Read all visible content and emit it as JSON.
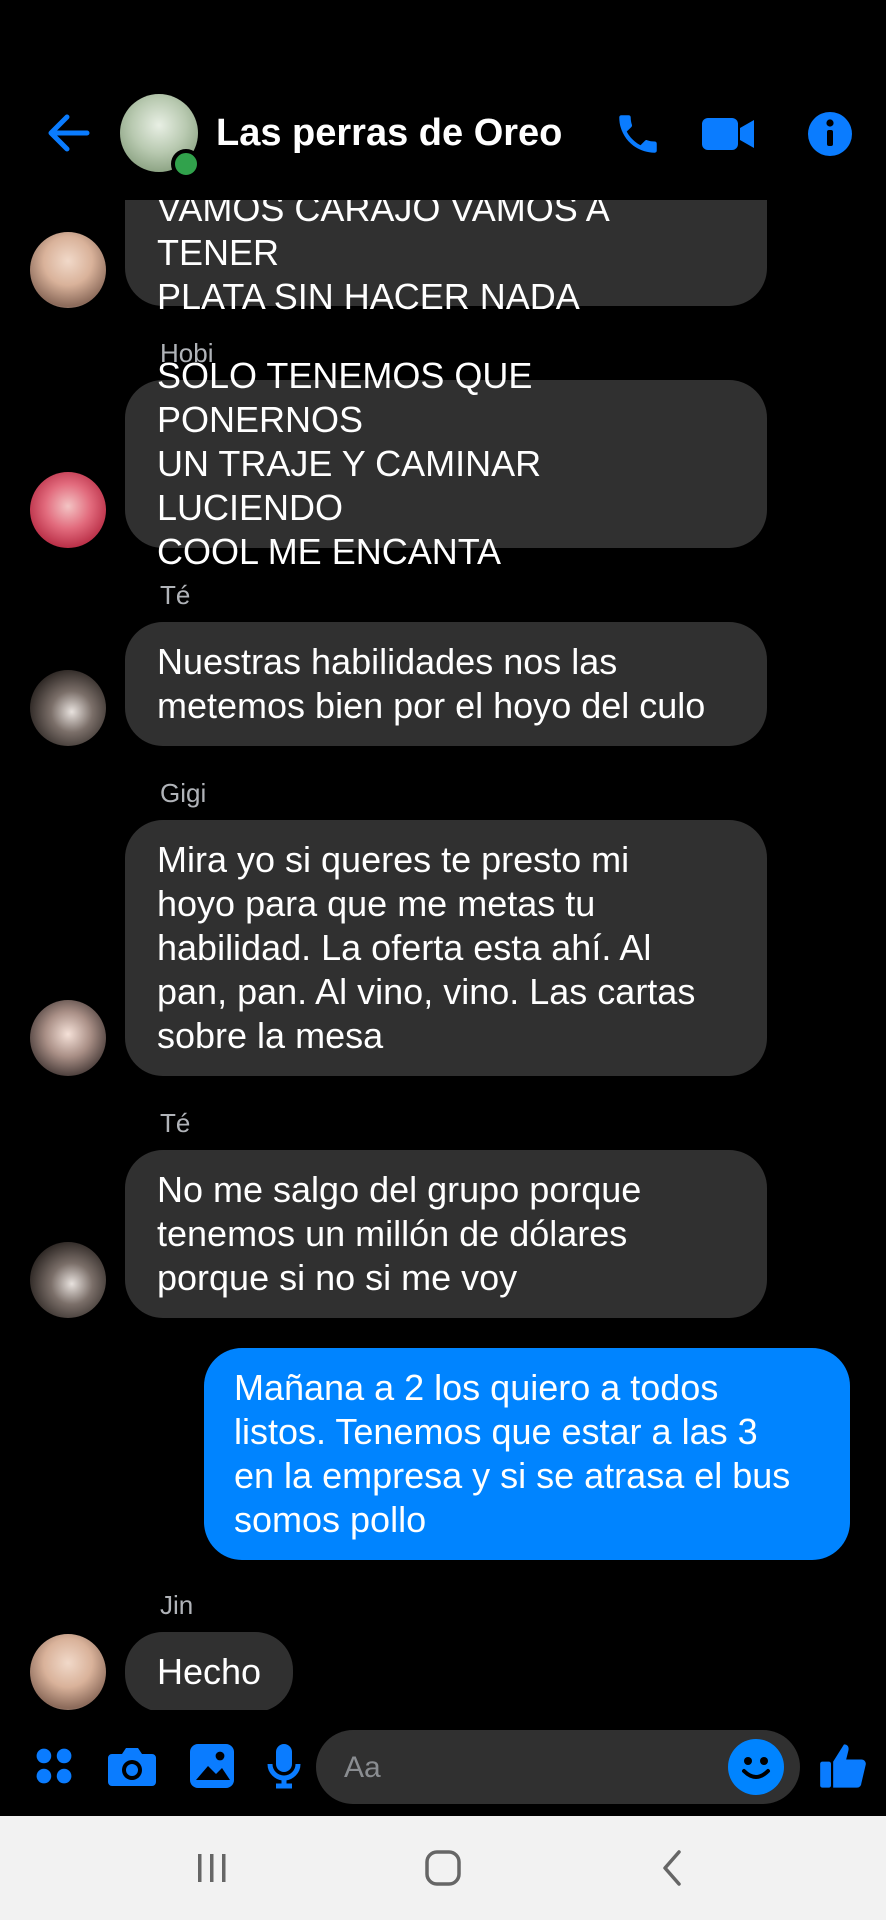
{
  "app": {
    "accent": "#0084ff",
    "incoming_bubble": "#303030",
    "background": "#000000"
  },
  "header": {
    "title": "Las perras de Oreo",
    "online": true,
    "icons": [
      "arrow-left-icon",
      "phone-icon",
      "video-camera-icon",
      "info-icon"
    ]
  },
  "messages": [
    {
      "direction": "in",
      "sender_label": "",
      "avatar": "jin",
      "lines": [
        "VAMOS CARAJO VAMOS A TENER",
        "PLATA SIN HACER NADA"
      ]
    },
    {
      "direction": "in",
      "sender_label": "Hobi",
      "avatar": "hobi",
      "lines": [
        "SOLO TENEMOS QUE PONERNOS",
        "UN TRAJE Y CAMINAR LUCIENDO",
        "COOL ME ENCANTA"
      ]
    },
    {
      "direction": "in",
      "sender_label": "Té",
      "avatar": "te",
      "lines": [
        "Nuestras habilidades nos las",
        "metemos bien por el hoyo del culo"
      ]
    },
    {
      "direction": "in",
      "sender_label": "Gigi",
      "avatar": "gigi",
      "lines": [
        "Mira yo si queres te presto mi",
        "hoyo para que me metas tu",
        "habilidad. La oferta esta ahí. Al",
        "pan, pan. Al vino, vino. Las cartas",
        "sobre la mesa"
      ]
    },
    {
      "direction": "in",
      "sender_label": "Té",
      "avatar": "te",
      "lines": [
        "No me salgo del grupo porque",
        "tenemos un millón de dólares",
        "porque si no si me voy"
      ]
    },
    {
      "direction": "out",
      "sender_label": "",
      "avatar": "",
      "lines": [
        "Mañana a 2 los quiero a todos",
        "listos. Tenemos que estar a las 3",
        "en la empresa y si se atrasa el bus",
        "somos pollo"
      ]
    },
    {
      "direction": "in",
      "sender_label": "Jin",
      "avatar": "jin",
      "lines": [
        "Hecho"
      ]
    }
  ],
  "composer": {
    "placeholder": "Aa",
    "icons": [
      "apps-grid-icon",
      "camera-icon",
      "gallery-icon",
      "microphone-icon",
      "emoji-icon",
      "thumbs-up-icon"
    ]
  },
  "navbar": {
    "icons": [
      "recent-apps-icon",
      "home-icon",
      "back-icon"
    ]
  }
}
